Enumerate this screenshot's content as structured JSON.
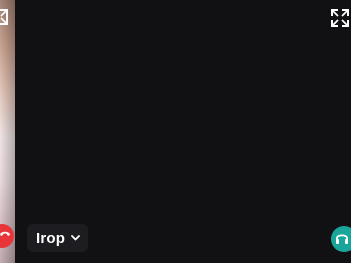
{
  "call": {
    "participant_name": "Irop",
    "self_view_visible": true,
    "main_video_state": "dark"
  },
  "icons": {
    "expand_left": "expand-icon",
    "expand_right": "expand-icon",
    "hangup": "phone-hangup-icon",
    "menu_chevron": "chevron-down-icon",
    "audio": "headphones-icon"
  },
  "colors": {
    "background": "#121215",
    "hangup": "#e8353a",
    "audio": "#1aa59b",
    "pill": "#1c1c21",
    "text": "#ffffff"
  }
}
